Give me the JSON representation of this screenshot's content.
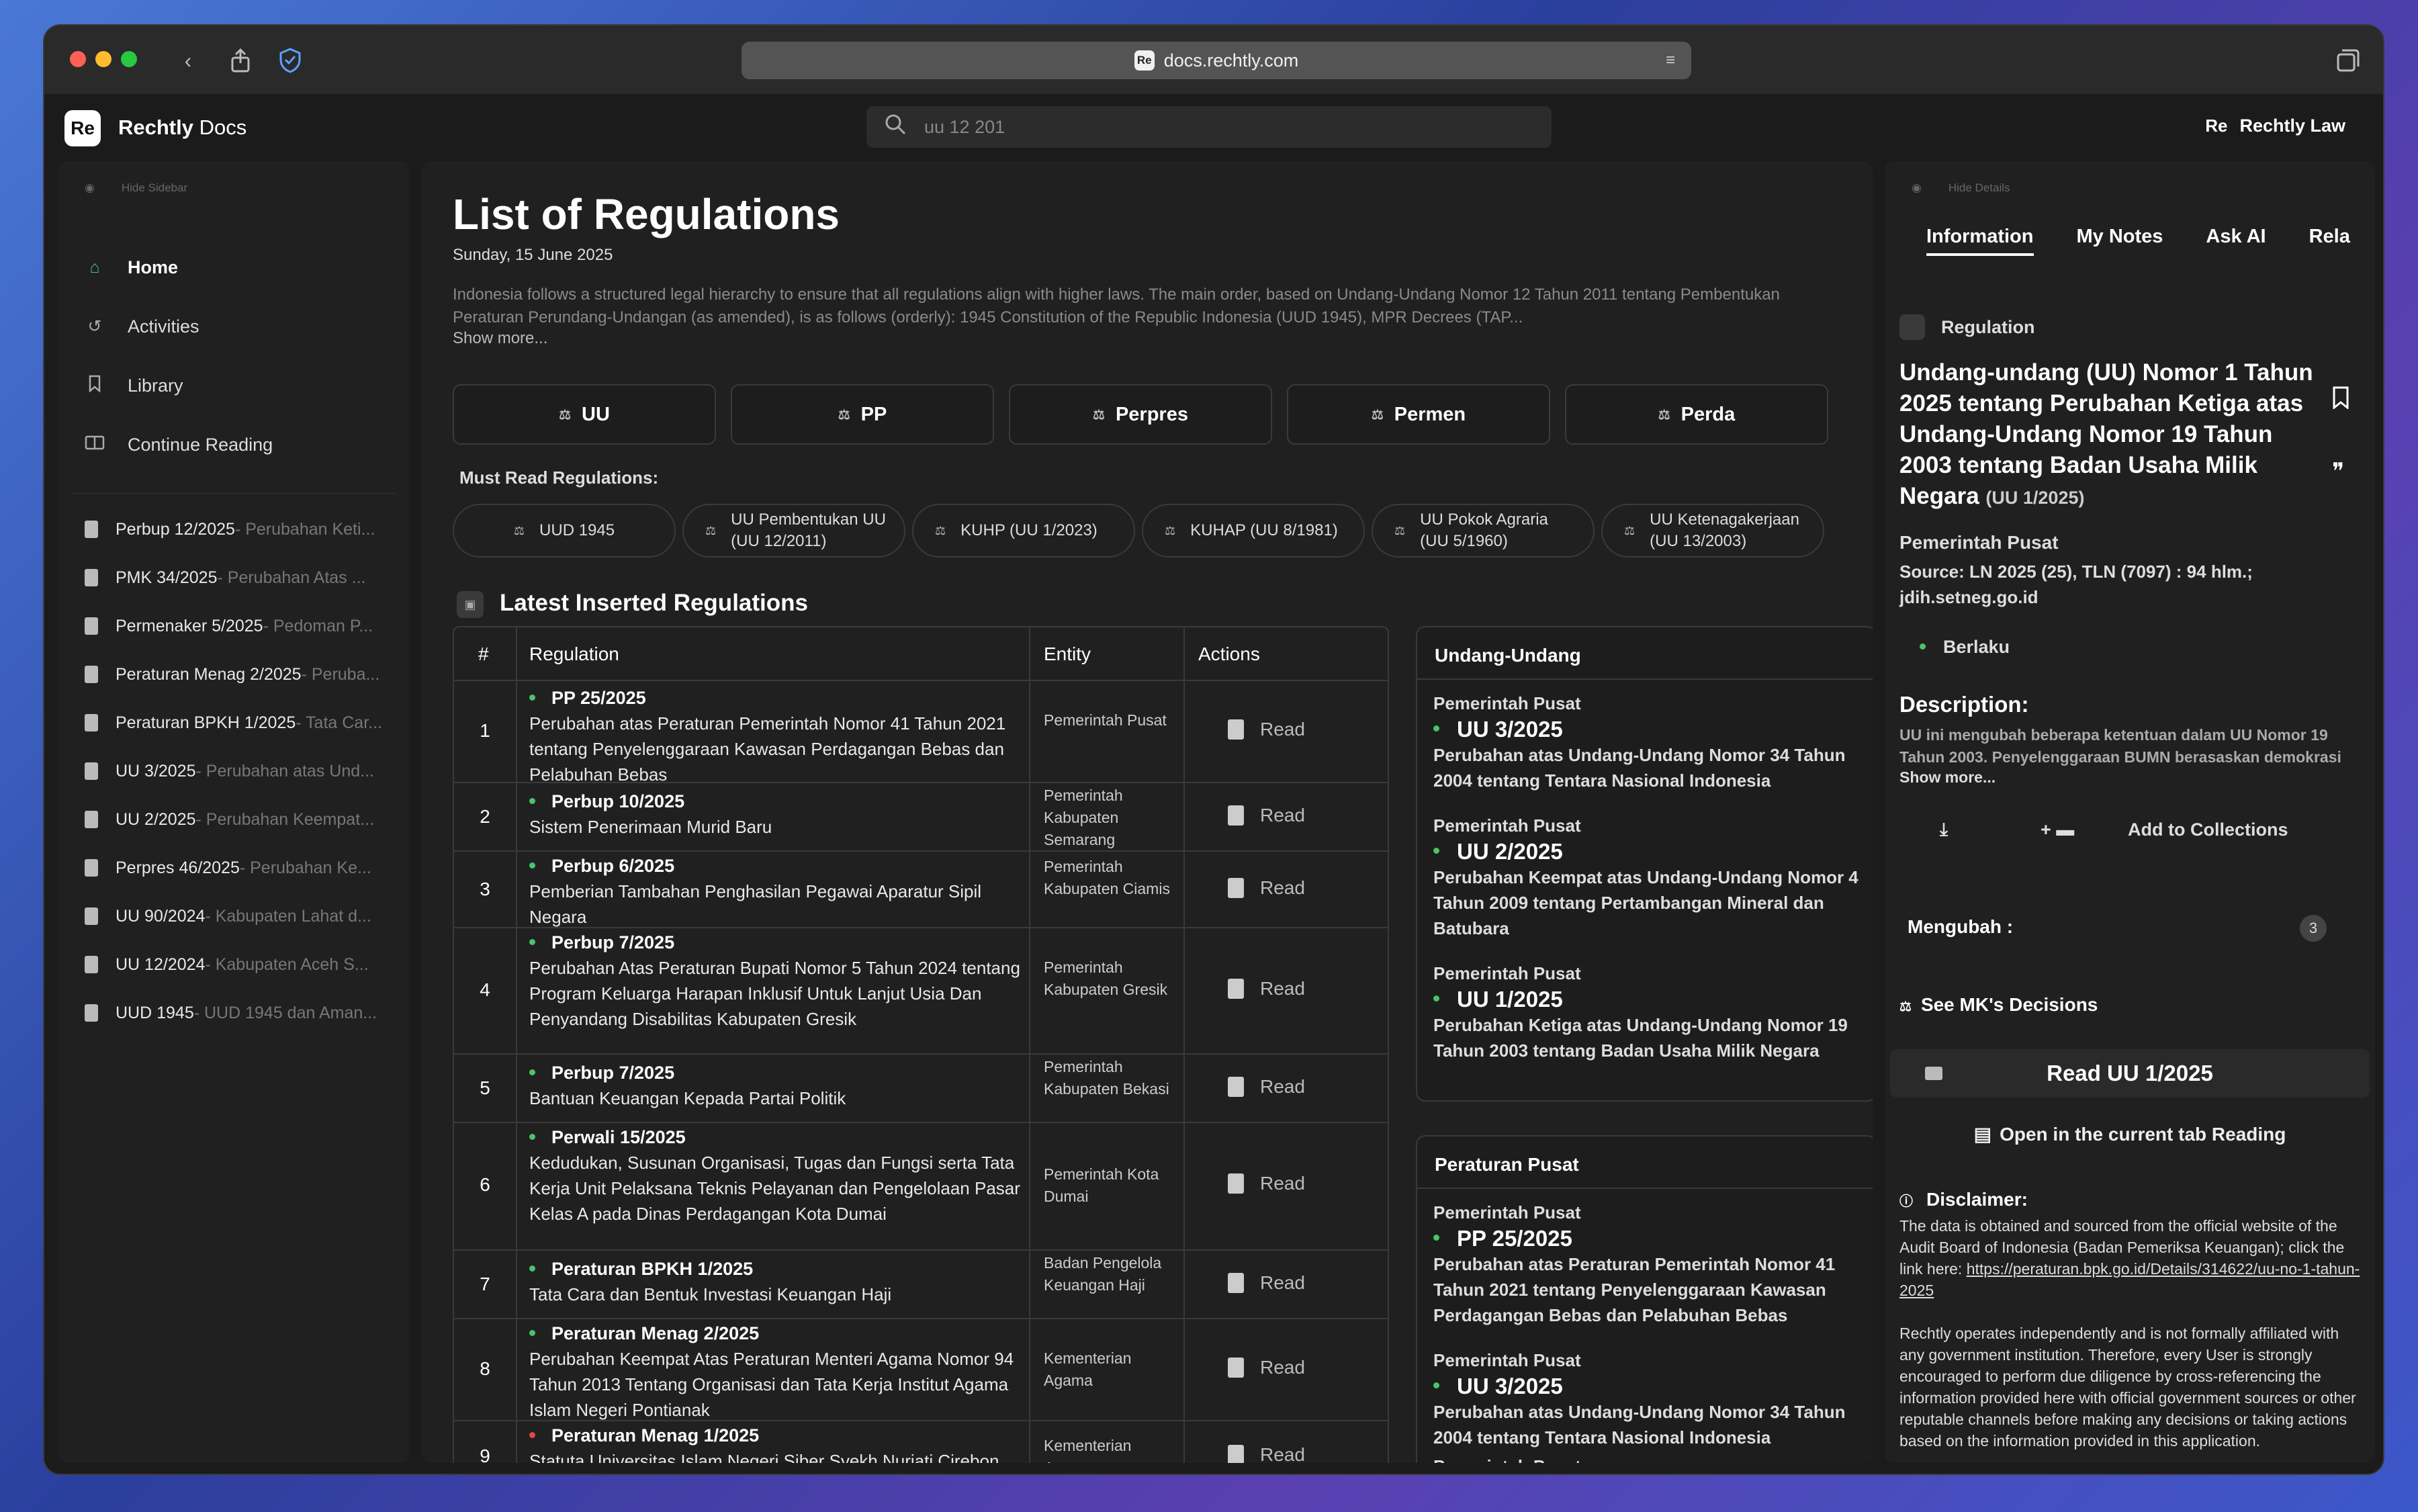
{
  "browser": {
    "url": "docs.rechtly.com",
    "favicon_text": "Re"
  },
  "app": {
    "logo_text": "Re",
    "brand_bold": "Rechtly",
    "brand_rest": " Docs",
    "search_placeholder": "uu 12 201",
    "user_logo": "Re",
    "user_name": "Rechtly Law"
  },
  "sidebar": {
    "hide_label": "Hide Sidebar",
    "nav": [
      {
        "label": "Home",
        "icon": "home-icon"
      },
      {
        "label": "Activities",
        "icon": "history-icon"
      },
      {
        "label": "Library",
        "icon": "bookmark-icon"
      },
      {
        "label": "Continue Reading",
        "icon": "book-open-icon"
      }
    ],
    "recent": [
      {
        "title": "Perbup 12/2025",
        "sub": " - Perubahan Keti..."
      },
      {
        "title": "PMK 34/2025",
        "sub": " - Perubahan Atas ..."
      },
      {
        "title": "Permenaker 5/2025",
        "sub": " - Pedoman P..."
      },
      {
        "title": "Peraturan Menag 2/2025",
        "sub": " - Peruba..."
      },
      {
        "title": "Peraturan BPKH 1/2025",
        "sub": " - Tata Car..."
      },
      {
        "title": "UU 3/2025",
        "sub": " - Perubahan atas Und..."
      },
      {
        "title": "UU 2/2025",
        "sub": " - Perubahan Keempat..."
      },
      {
        "title": "Perpres 46/2025",
        "sub": " - Perubahan Ke..."
      },
      {
        "title": "UU 90/2024",
        "sub": " - Kabupaten Lahat d..."
      },
      {
        "title": "UU 12/2024",
        "sub": " - Kabupaten Aceh S..."
      },
      {
        "title": "UUD 1945",
        "sub": " - UUD 1945 dan Aman..."
      }
    ]
  },
  "main": {
    "title": "List of Regulations",
    "date": "Sunday, 15 June 2025",
    "intro": "Indonesia follows a structured legal hierarchy to ensure that all regulations align with higher laws. The main order, based on Undang-Undang Nomor 12 Tahun 2011 tentang Pembentukan Peraturan Perundang-Undangan (as amended), is as follows (orderly): 1945 Constitution of the Republic Indonesia (UUD 1945), MPR Decrees (TAP...",
    "show_more": "Show more...",
    "hierarchy": [
      "UU",
      "PP",
      "Perpres",
      "Permen",
      "Perda"
    ],
    "must_read_label": "Must Read Regulations:",
    "must_read": [
      {
        "l1": "UUD 1945",
        "l2": ""
      },
      {
        "l1": "UU Pembentukan UU",
        "l2": "(UU 12/2011)"
      },
      {
        "l1": "KUHP (UU 1/2023)",
        "l2": ""
      },
      {
        "l1": "KUHAP (UU 8/1981)",
        "l2": ""
      },
      {
        "l1": "UU Pokok Agraria",
        "l2": "(UU 5/1960)"
      },
      {
        "l1": "UU Ketenagakerjaan",
        "l2": "(UU 13/2003)"
      }
    ],
    "latest_title": "Latest Inserted Regulations",
    "table": {
      "headers": [
        "#",
        "Regulation",
        "Entity",
        "Actions"
      ],
      "action_label": "Read",
      "rows": [
        {
          "num": "1",
          "title": "PP 25/2025",
          "desc": "Perubahan atas Peraturan Pemerintah Nomor 41 Tahun 2021 tentang Penyelenggaraan Kawasan Perdagangan Bebas dan Pelabuhan Bebas",
          "entity": "Pemerintah Pusat",
          "status": "green"
        },
        {
          "num": "2",
          "title": "Perbup 10/2025",
          "desc": "Sistem Penerimaan Murid Baru",
          "entity": "Pemerintah Kabupaten Semarang",
          "status": "green"
        },
        {
          "num": "3",
          "title": "Perbup 6/2025",
          "desc": "Pemberian Tambahan Penghasilan Pegawai Aparatur Sipil Negara",
          "entity": "Pemerintah Kabupaten Ciamis",
          "status": "green"
        },
        {
          "num": "4",
          "title": "Perbup 7/2025",
          "desc": "Perubahan Atas Peraturan Bupati Nomor 5 Tahun 2024 tentang Program Keluarga Harapan Inklusif Untuk Lanjut Usia Dan Penyandang Disabilitas Kabupaten Gresik",
          "entity": "Pemerintah Kabupaten Gresik",
          "status": "green"
        },
        {
          "num": "5",
          "title": "Perbup 7/2025",
          "desc": "Bantuan Keuangan Kepada Partai Politik",
          "entity": "Pemerintah Kabupaten Bekasi",
          "status": "green"
        },
        {
          "num": "6",
          "title": "Perwali 15/2025",
          "desc": "Kedudukan, Susunan Organisasi, Tugas dan Fungsi serta Tata Kerja Unit Pelaksana Teknis Pelayanan dan Pengelolaan Pasar Kelas A pada Dinas Perdagangan Kota Dumai",
          "entity": "Pemerintah Kota Dumai",
          "status": "green"
        },
        {
          "num": "7",
          "title": "Peraturan BPKH 1/2025",
          "desc": "Tata Cara dan Bentuk Investasi Keuangan Haji",
          "entity": "Badan Pengelola Keuangan Haji",
          "status": "green"
        },
        {
          "num": "8",
          "title": "Peraturan Menag 2/2025",
          "desc": "Perubahan Keempat Atas Peraturan Menteri Agama Nomor 94 Tahun 2013 Tentang Organisasi dan Tata Kerja Institut Agama Islam Negeri Pontianak",
          "entity": "Kementerian Agama",
          "status": "green"
        },
        {
          "num": "9",
          "title": "Peraturan Menag 1/2025",
          "desc": "Statuta Universitas Islam Negeri Siber Syekh Nurjati Cirebon",
          "entity": "Kementerian Agama",
          "status": "red"
        }
      ]
    },
    "cards": [
      {
        "title": "Undang-Undang",
        "items": [
          {
            "entity": "Pemerintah Pusat",
            "num": "UU 3/2025",
            "desc": "Perubahan atas Undang-Undang Nomor 34 Tahun 2004 tentang Tentara Nasional Indonesia"
          },
          {
            "entity": "Pemerintah Pusat",
            "num": "UU 2/2025",
            "desc": "Perubahan Keempat atas Undang-Undang Nomor 4 Tahun 2009 tentang Pertambangan Mineral dan Batubara"
          },
          {
            "entity": "Pemerintah Pusat",
            "num": "UU 1/2025",
            "desc": "Perubahan Ketiga atas Undang-Undang Nomor 19 Tahun 2003 tentang Badan Usaha Milik Negara"
          }
        ]
      },
      {
        "title": "Peraturan Pusat",
        "items": [
          {
            "entity": "Pemerintah Pusat",
            "num": "PP 25/2025",
            "desc": "Perubahan atas Peraturan Pemerintah Nomor 41 Tahun 2021 tentang Penyelenggaraan Kawasan Perdagangan Bebas dan Pelabuhan Bebas"
          },
          {
            "entity": "Pemerintah Pusat",
            "num": "UU 3/2025",
            "desc": "Perubahan atas Undang-Undang Nomor 34 Tahun 2004 tentang Tentara Nasional Indonesia"
          },
          {
            "entity": "Pemerintah Pusat",
            "num": "",
            "desc": ""
          }
        ]
      }
    ]
  },
  "details": {
    "hide_label": "Hide Details",
    "tabs": [
      "Information",
      "My Notes",
      "Ask AI",
      "Rela"
    ],
    "type": "Regulation",
    "title": "Undang-undang (UU) Nomor 1 Tahun 2025 tentang Perubahan Ketiga atas Undang-Undang Nomor 19 Tahun 2003 tentang Badan Usaha Milik Negara",
    "short": "(UU 1/2025)",
    "entity": "Pemerintah Pusat",
    "source": "Source: LN 2025 (25), TLN (7097) : 94 hlm.; jdih.setneg.go.id",
    "status": "Berlaku",
    "desc_label": "Description:",
    "desc": "UU ini mengubah beberapa ketentuan dalam UU Nomor 19 Tahun 2003. Penyelenggaraan BUMN berasaskan demokrasi ekonomi yang meliputi prinsip: kebersamaa...",
    "show_more": "Show more...",
    "add_collections": "Add to Collections",
    "mengubah_label": "Mengubah :",
    "mengubah_count": "3",
    "mk_label": "See  MK's Decisions",
    "read_label": "Read UU 1/2025",
    "open_label": "Open in the current tab Reading",
    "disclaimer_title": "Disclaimer:",
    "disclaimer_1": "The data is obtained and sourced from the official website of the Audit Board of Indonesia (Badan Pemeriksa Keuangan); click the link here: ",
    "disclaimer_link": "https://peraturan.bpk.go.id/Details/314622/uu-no-1-tahun-2025",
    "disclaimer_2": "Rechtly operates independently and is not formally affiliated with any government institution. Therefore, every User is strongly encouraged to perform due diligence by cross-referencing the information provided here with official government sources or other reputable channels before making any decisions or taking actions based on the information provided in this application."
  },
  "colors": {
    "accent_green": "#4cc36b",
    "alert_red": "#e04848",
    "traffic_red": "#ff5f57",
    "traffic_yellow": "#febc2e",
    "traffic_green": "#28c840"
  }
}
